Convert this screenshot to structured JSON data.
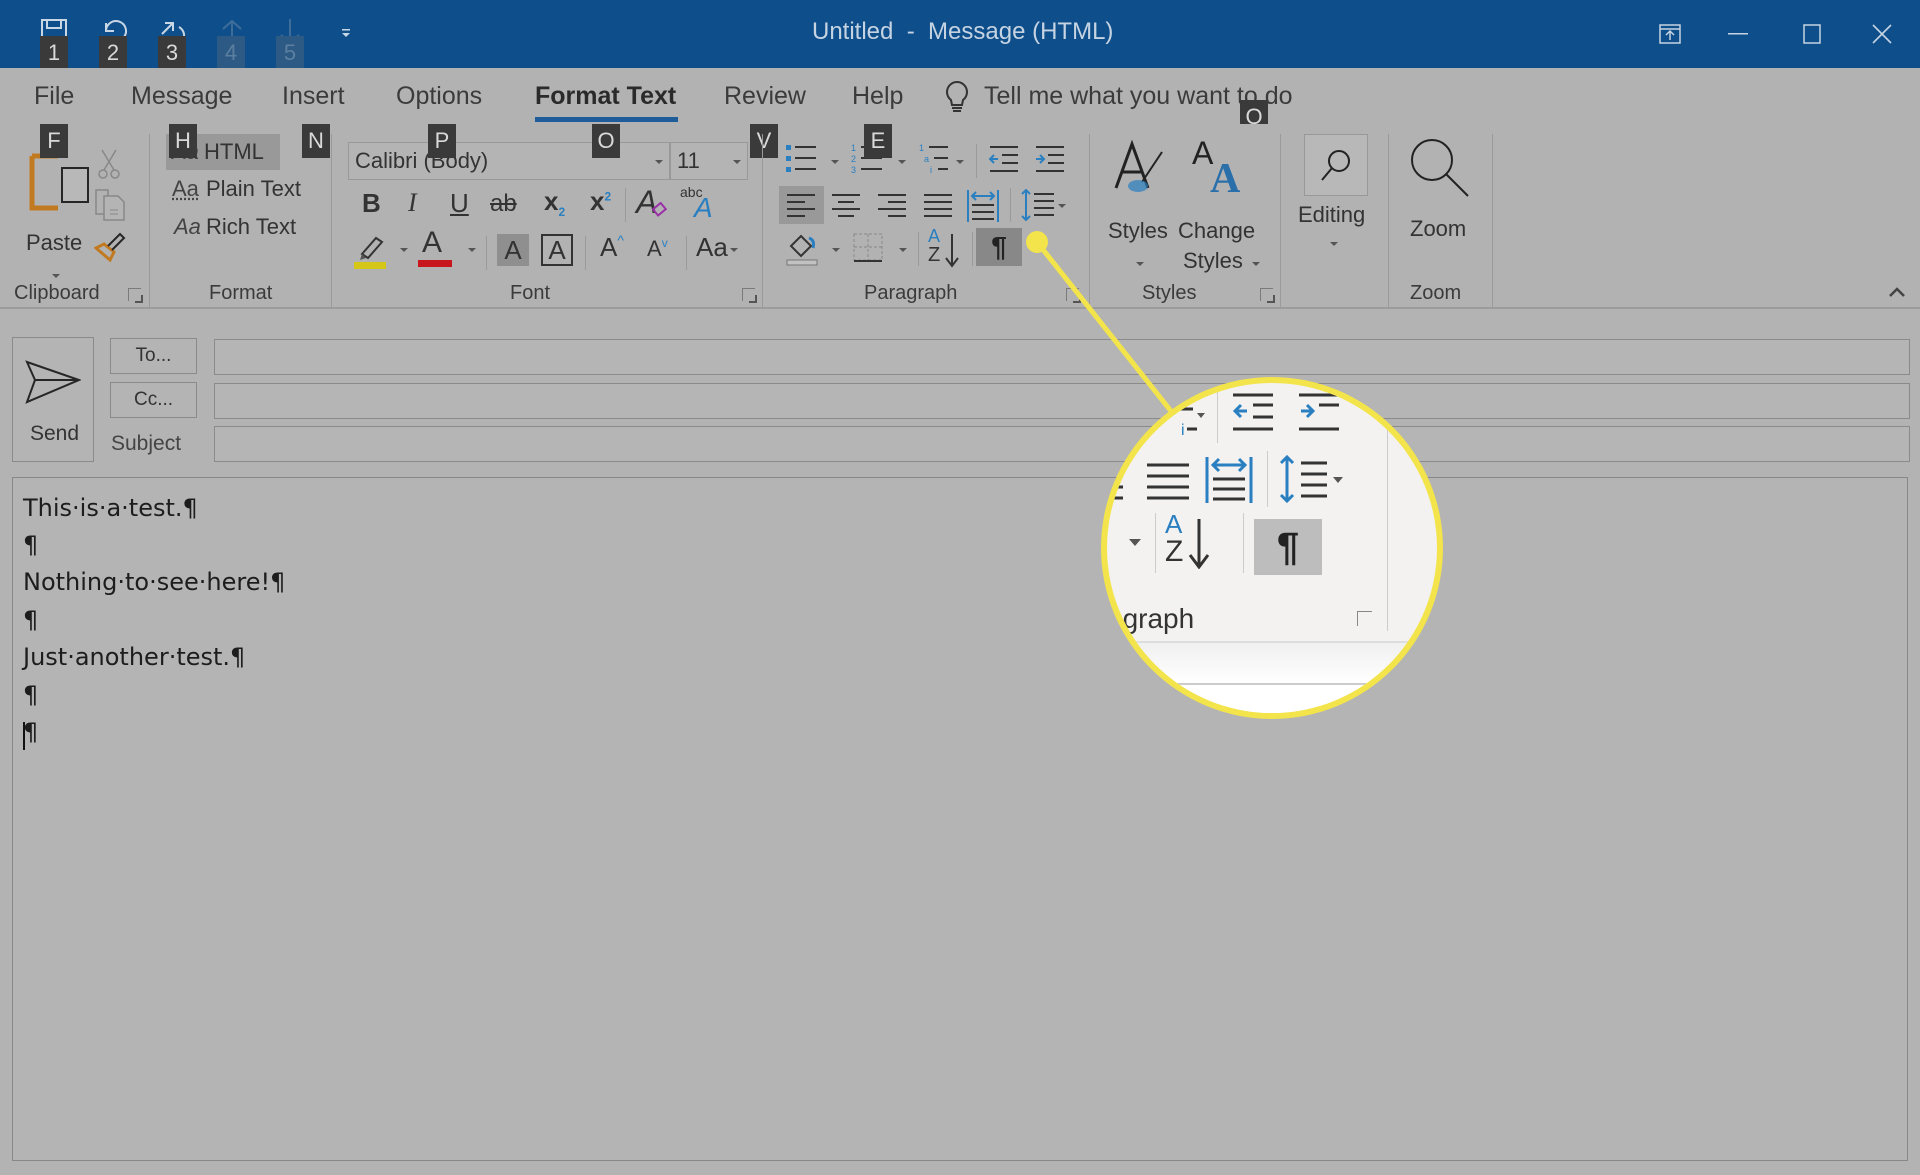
{
  "window": {
    "title": "Untitled  -  Message (HTML)",
    "controls": [
      "ribbon-display-options",
      "minimize",
      "maximize",
      "close"
    ]
  },
  "quick_access": [
    {
      "icon": "save-icon",
      "keytip": "1",
      "enabled": true
    },
    {
      "icon": "undo-icon",
      "keytip": "2",
      "enabled": true
    },
    {
      "icon": "redo-icon",
      "keytip": "3",
      "enabled": true
    },
    {
      "icon": "up-arrow-icon",
      "keytip": "4",
      "enabled": false
    },
    {
      "icon": "down-arrow-icon",
      "keytip": "5",
      "enabled": false
    },
    {
      "icon": "customize-qat-icon",
      "keytip": "",
      "enabled": true
    }
  ],
  "tabs": [
    {
      "label": "File",
      "active": false
    },
    {
      "label": "Message",
      "active": false
    },
    {
      "label": "Insert",
      "active": false
    },
    {
      "label": "Options",
      "active": false
    },
    {
      "label": "Format Text",
      "active": true
    },
    {
      "label": "Review",
      "active": false
    },
    {
      "label": "Help",
      "active": false
    }
  ],
  "tell_me": {
    "label": "Tell me what you want to do",
    "keytip": "Q"
  },
  "keytips": {
    "F": "F",
    "H": "H",
    "N": "N",
    "P": "P",
    "O": "O",
    "V": "V",
    "E": "E"
  },
  "ribbon": {
    "clipboard": {
      "label": "Clipboard",
      "paste_label": "Paste"
    },
    "format": {
      "label": "Format",
      "items": [
        {
          "prefix": "Aa",
          "label": "HTML",
          "selected": true
        },
        {
          "prefix": "Aa",
          "label": "Plain Text",
          "selected": false
        },
        {
          "prefix": "Aa",
          "label": "Rich Text",
          "selected": false
        }
      ]
    },
    "font": {
      "label": "Font",
      "font_name": "Calibri (Body)",
      "font_size": "11",
      "bold": "B",
      "italic": "I",
      "underline": "U",
      "strikethrough": "ab",
      "subscript": "x",
      "subscript_sub": "2",
      "superscript": "x",
      "superscript_sup": "2",
      "clear_formatting": "A",
      "text_effects_small": "abc",
      "text_effects": "A",
      "highlight_color": "#d4c718",
      "font_color": "#c8161d",
      "char_shading": "A",
      "char_border": "A",
      "grow_font": "A",
      "shrink_font": "A",
      "change_case": "Aa"
    },
    "paragraph": {
      "label": "Paragraph",
      "show_marks_active": true,
      "show_marks_glyph": "¶",
      "sort_a": "A",
      "sort_z": "Z"
    },
    "styles": {
      "label": "Styles",
      "styles_label": "Styles",
      "change_styles_label_1": "Change",
      "change_styles_label_2": "Styles"
    },
    "editing": {
      "label": "Editing"
    },
    "zoom": {
      "label": "Zoom",
      "group_label": "Zoom"
    }
  },
  "compose": {
    "send_label": "Send",
    "to_label": "To...",
    "cc_label": "Cc...",
    "subject_label": "Subject",
    "to_value": "",
    "cc_value": "",
    "subject_value": ""
  },
  "body_lines": [
    "This·is·a·test.¶",
    "¶",
    "Nothing·to·see·here!¶",
    "¶",
    "Just·another·test.¶",
    "¶",
    "¶"
  ],
  "callout": {
    "label_fragment": "agraph",
    "highlight_color": "#f2e44a",
    "glyph": "¶"
  },
  "colors": {
    "titlebar": "#0e4f8b",
    "accent": "#1f5c9a",
    "icon_blue": "#2a7fc1"
  }
}
